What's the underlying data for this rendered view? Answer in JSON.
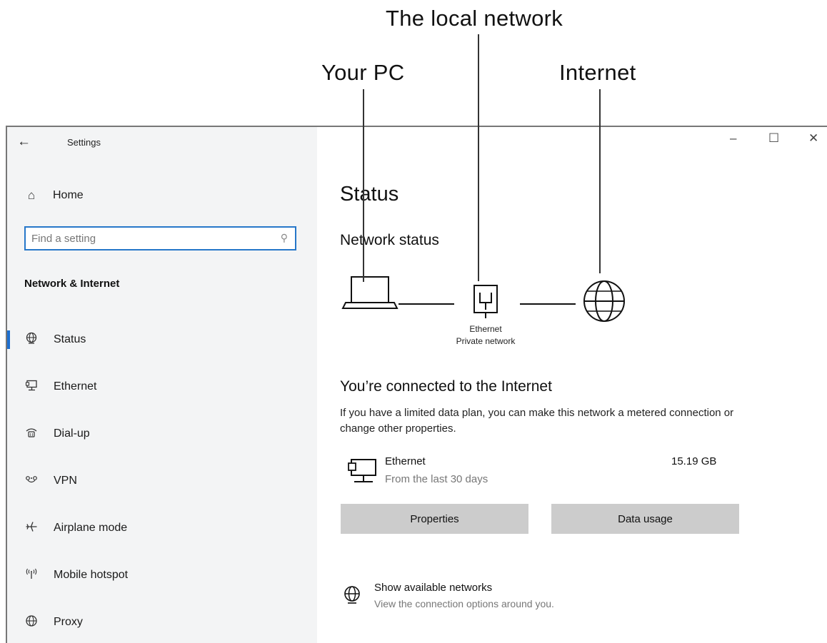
{
  "callouts": {
    "your_pc": "Your PC",
    "local_network": "The local network",
    "internet": "Internet"
  },
  "titlebar": {
    "back_icon": "back-arrow-icon",
    "title": "Settings",
    "minimize": "–",
    "maximize": "☐",
    "close": "✕"
  },
  "sidebar": {
    "home_label": "Home",
    "search": {
      "placeholder": "Find a setting",
      "value": ""
    },
    "section_heading": "Network & Internet",
    "items": [
      {
        "icon": "status-globe-icon",
        "label": "Status",
        "active": true
      },
      {
        "icon": "ethernet-icon",
        "label": "Ethernet",
        "active": false
      },
      {
        "icon": "dial-up-icon",
        "label": "Dial-up",
        "active": false
      },
      {
        "icon": "vpn-icon",
        "label": "VPN",
        "active": false
      },
      {
        "icon": "airplane-icon",
        "label": "Airplane mode",
        "active": false
      },
      {
        "icon": "mobile-hotspot-icon",
        "label": "Mobile hotspot",
        "active": false
      },
      {
        "icon": "proxy-globe-icon",
        "label": "Proxy",
        "active": false
      }
    ]
  },
  "main": {
    "page_title": "Status",
    "section_title": "Network status",
    "diagram": {
      "node_label": "Ethernet",
      "node_sublabel": "Private network"
    },
    "connected_title": "You’re connected to the Internet",
    "connected_desc": "If you have a limited data plan, you can make this network a metered connection or change other properties.",
    "connection": {
      "name": "Ethernet",
      "subtitle": "From the last 30 days",
      "usage": "15.19 GB"
    },
    "buttons": {
      "properties": "Properties",
      "data_usage": "Data usage"
    },
    "show_networks": {
      "title": "Show available networks",
      "subtitle": "View the connection options around you."
    }
  },
  "colors": {
    "accent": "#1d6fcf",
    "sidebar_bg": "#f3f4f5",
    "button_bg": "#cccccc"
  }
}
